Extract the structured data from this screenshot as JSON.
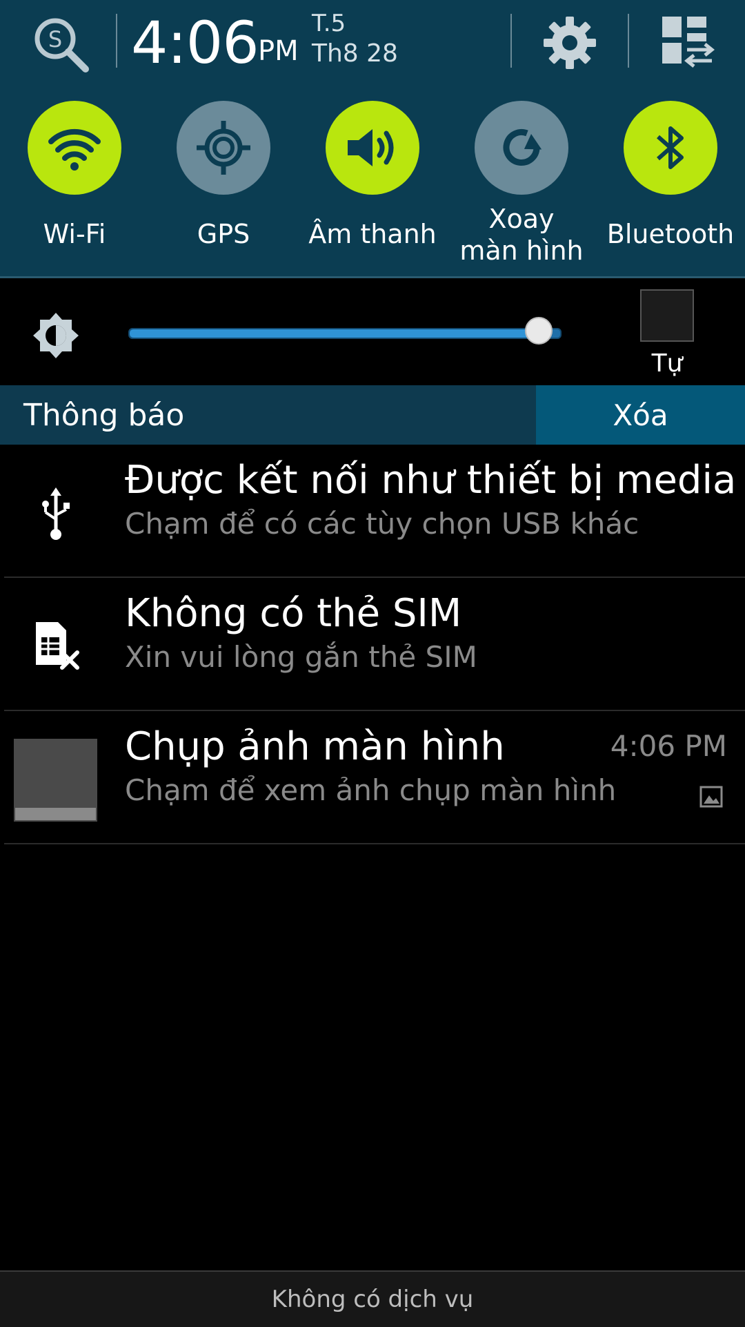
{
  "status": {
    "time": "4:06",
    "ampm": "PM",
    "day": "T.5",
    "date": "Th8 28"
  },
  "quick_settings": [
    {
      "label": "Wi-Fi",
      "icon": "wifi-icon",
      "state": "on"
    },
    {
      "label": "GPS",
      "icon": "gps-icon",
      "state": "off"
    },
    {
      "label": "Âm thanh",
      "icon": "sound-icon",
      "state": "on"
    },
    {
      "label_line1": "Xoay",
      "label_line2": "màn hình",
      "icon": "rotate-icon",
      "state": "off"
    },
    {
      "label": "Bluetooth",
      "icon": "bluetooth-icon",
      "state": "on"
    }
  ],
  "brightness": {
    "level": 0.95,
    "auto_label": "Tự"
  },
  "notifications_header": {
    "title": "Thông báo",
    "clear_label": "Xóa"
  },
  "notifications": [
    {
      "title": "Được kết nối như thiết bị media",
      "subtitle": "Chạm để có các tùy chọn USB khác",
      "icon": "usb-icon"
    },
    {
      "title": "Không có thẻ SIM",
      "subtitle": "Xin vui lòng gắn thẻ SIM",
      "icon": "no-sim-icon"
    },
    {
      "title": "Chụp ảnh màn hình",
      "subtitle": "Chạm để xem ảnh chụp màn hình",
      "time": "4:06 PM",
      "icon": "image-icon"
    }
  ],
  "bottom_bar": {
    "text": "Không có dịch vụ"
  },
  "colors": {
    "header_bg": "#0b3d52",
    "toggle_on": "#b9e60e",
    "toggle_off": "#6b8b9a",
    "clear_bg": "#045879"
  }
}
